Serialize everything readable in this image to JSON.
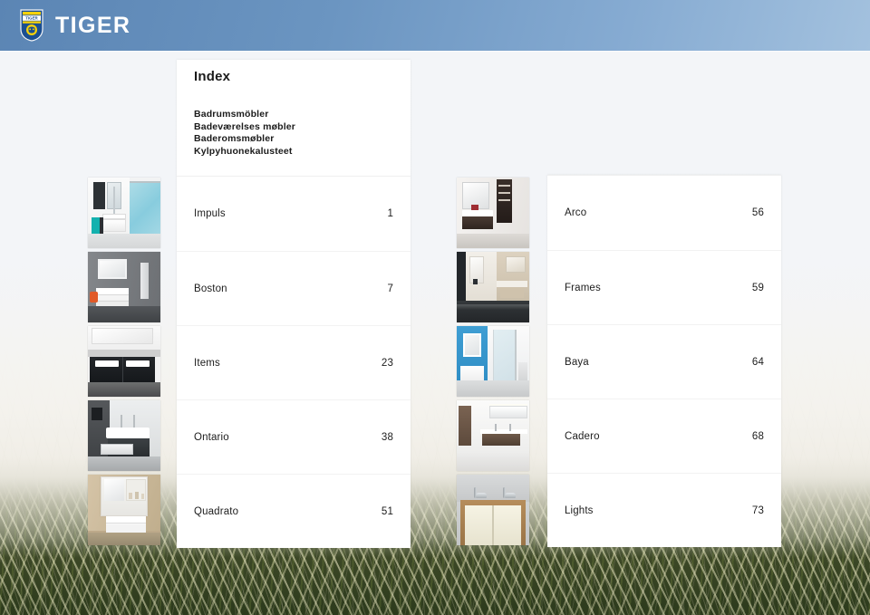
{
  "header": {
    "brand": "TIGER",
    "logo_icon": "tiger-shield-crest-icon",
    "colors": {
      "gradient_start": "#5b85b4",
      "gradient_end": "#a3c1de",
      "crest_blue": "#1b4f91",
      "crest_yellow": "#f5d10a",
      "brand_text": "#ffffff"
    }
  },
  "index": {
    "title": "Index",
    "languages": [
      "Badrumsmöbler",
      "Badeværelses møbler",
      "Baderomsmøbler",
      "Kylpyhuonekalusteet"
    ]
  },
  "columns": {
    "left": [
      {
        "name": "Impuls",
        "page": "1",
        "thumb": "impuls-bathroom-thumbnail"
      },
      {
        "name": "Boston",
        "page": "7",
        "thumb": "boston-bathroom-thumbnail"
      },
      {
        "name": "Items",
        "page": "23",
        "thumb": "items-bathroom-thumbnail"
      },
      {
        "name": "Ontario",
        "page": "38",
        "thumb": "ontario-bathroom-thumbnail"
      },
      {
        "name": "Quadrato",
        "page": "51",
        "thumb": "quadrato-bathroom-thumbnail"
      }
    ],
    "right": [
      {
        "name": "Arco",
        "page": "56",
        "thumb": "arco-bathroom-thumbnail"
      },
      {
        "name": "Frames",
        "page": "59",
        "thumb": "frames-bathroom-thumbnail"
      },
      {
        "name": "Baya",
        "page": "64",
        "thumb": "baya-bathroom-thumbnail"
      },
      {
        "name": "Cadero",
        "page": "68",
        "thumb": "cadero-bathroom-thumbnail"
      },
      {
        "name": "Lights",
        "page": "73",
        "thumb": "lights-mirror-thumbnail"
      }
    ]
  },
  "background": {
    "scene": "beach-dune-grass-photo",
    "sky_color": "#eef1f5",
    "grass_color": "#3f4a28"
  }
}
